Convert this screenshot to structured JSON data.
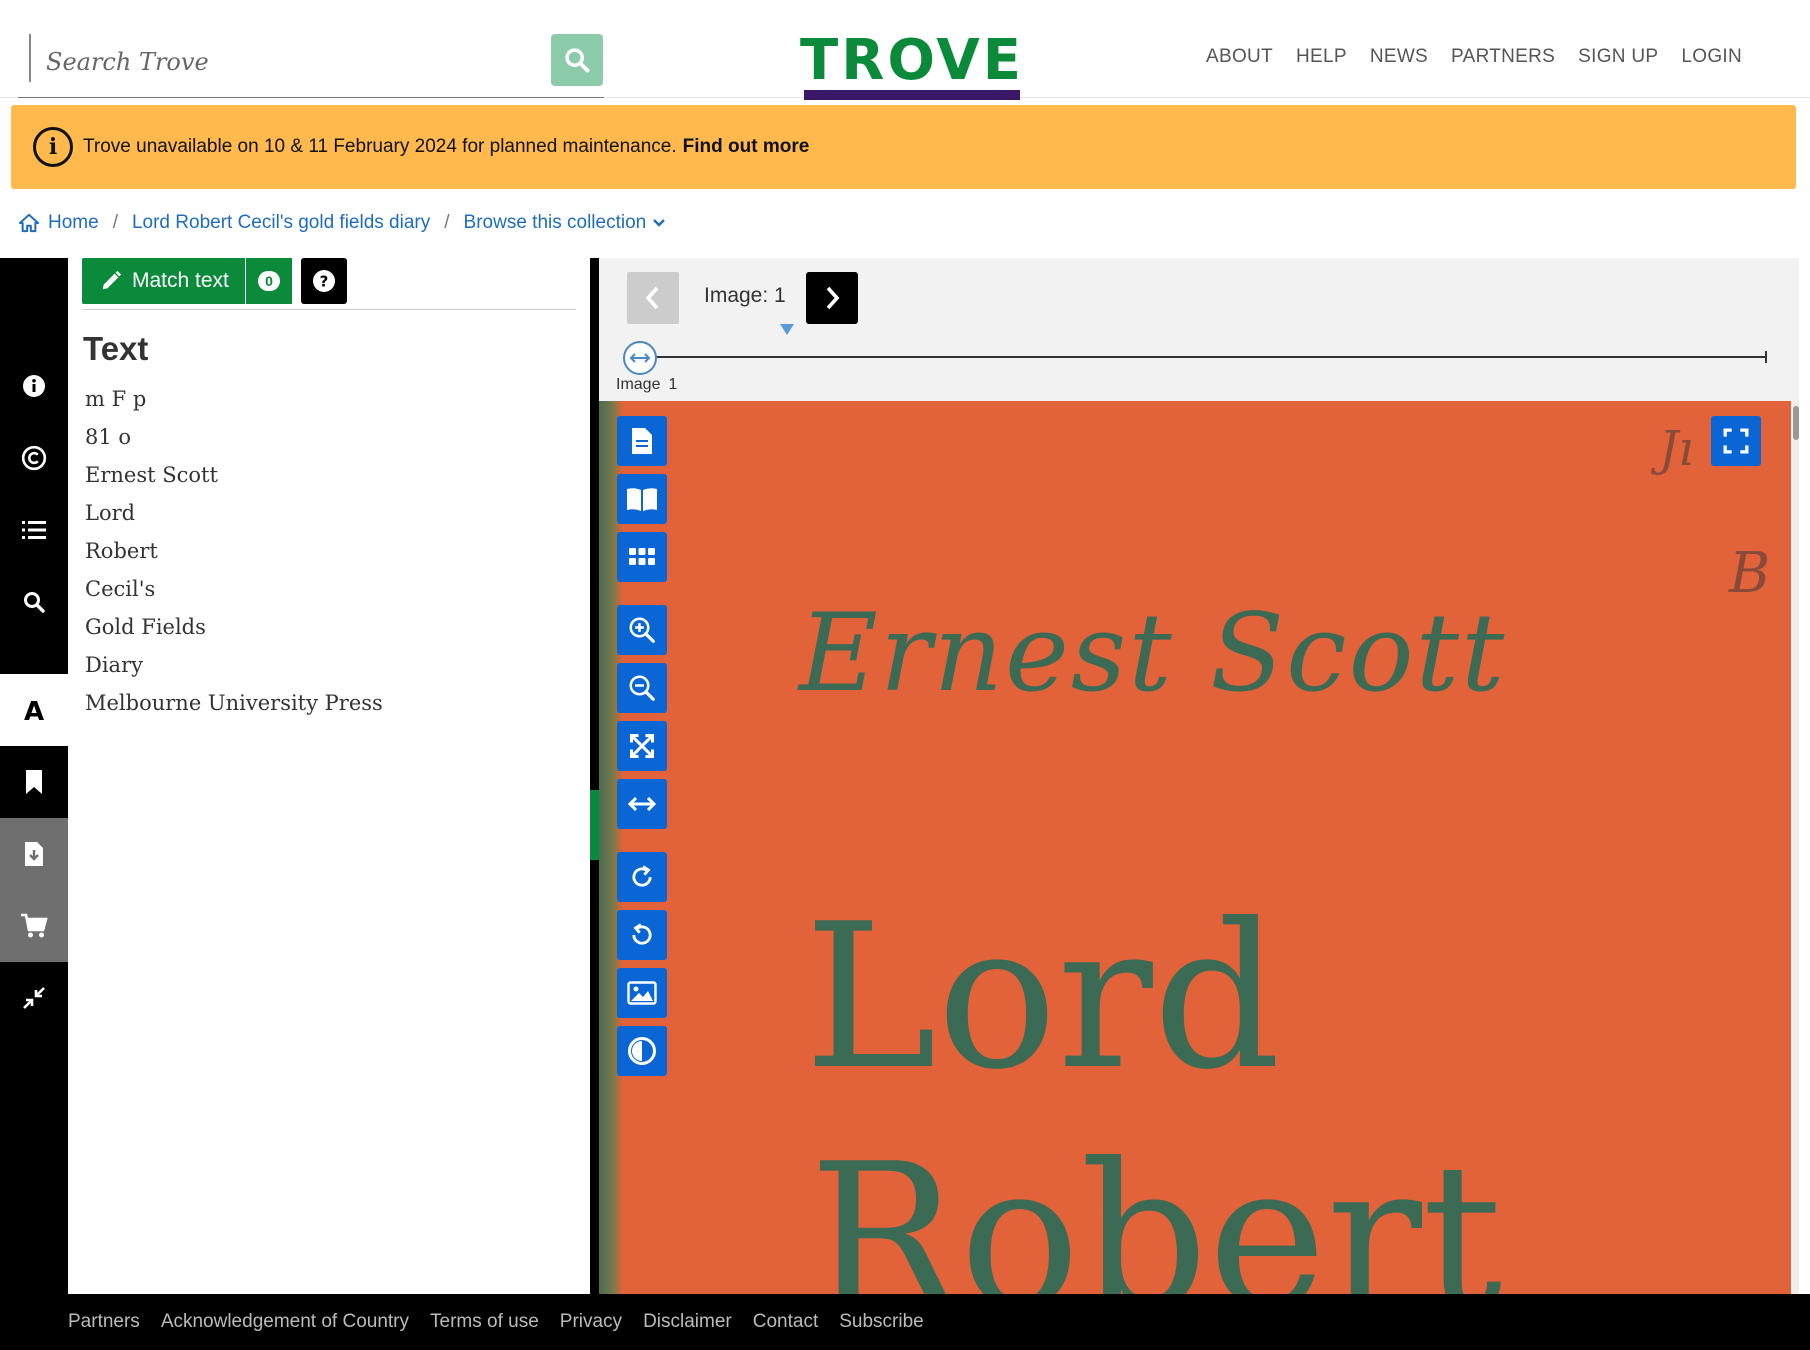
{
  "header": {
    "search_placeholder": "Search Trove",
    "logo_text": "TROVE",
    "nav": [
      "ABOUT",
      "HELP",
      "NEWS",
      "PARTNERS",
      "SIGN UP",
      "LOGIN"
    ]
  },
  "banner": {
    "message": "Trove unavailable on 10 & 11 February 2024 for planned maintenance.",
    "link": "Find out more",
    "color": "#ffb94d"
  },
  "breadcrumb": {
    "home": "Home",
    "item": "Lord Robert Cecil's gold fields diary",
    "browse": "Browse this collection"
  },
  "sidebar": {
    "icons": [
      "info-icon",
      "copyright-icon",
      "list-icon",
      "search-icon",
      "text-icon",
      "bookmark-icon",
      "download-icon",
      "cart-icon",
      "collapse-icon"
    ],
    "active": "text-icon"
  },
  "text_panel": {
    "match_label": "Match text",
    "match_count": "0",
    "heading": "Text",
    "lines": [
      "m F p",
      "81 o",
      "Ernest Scott",
      "Lord",
      "Robert",
      "Cecil's",
      "Gold Fields",
      "Diary",
      "Melbourne University Press"
    ]
  },
  "viewer": {
    "image_label": "Image: 1",
    "slider_caption_label": "Image",
    "slider_caption_num": "1",
    "current_image": 1,
    "tools": [
      "page-icon",
      "book-icon",
      "grid-icon",
      "zoom-in-icon",
      "zoom-out-icon",
      "fit-icon",
      "fit-width-icon",
      "rotate-right-icon",
      "rotate-left-icon",
      "image-icon",
      "contrast-icon"
    ],
    "scan": {
      "author": "Ernest  Scott",
      "title1": "Lord",
      "title2": "Robert",
      "margin1": "Jı",
      "margin2": "B"
    }
  },
  "footer": {
    "links": [
      "Partners",
      "Acknowledgement of Country",
      "Terms of use",
      "Privacy",
      "Disclaimer",
      "Contact",
      "Subscribe"
    ]
  },
  "colors": {
    "brand_green": "#0a8a3a",
    "brand_purple": "#3a1868",
    "link_blue": "#1f6cbf",
    "tool_blue": "#0a66d4",
    "scan_orange": "#e2623a"
  }
}
